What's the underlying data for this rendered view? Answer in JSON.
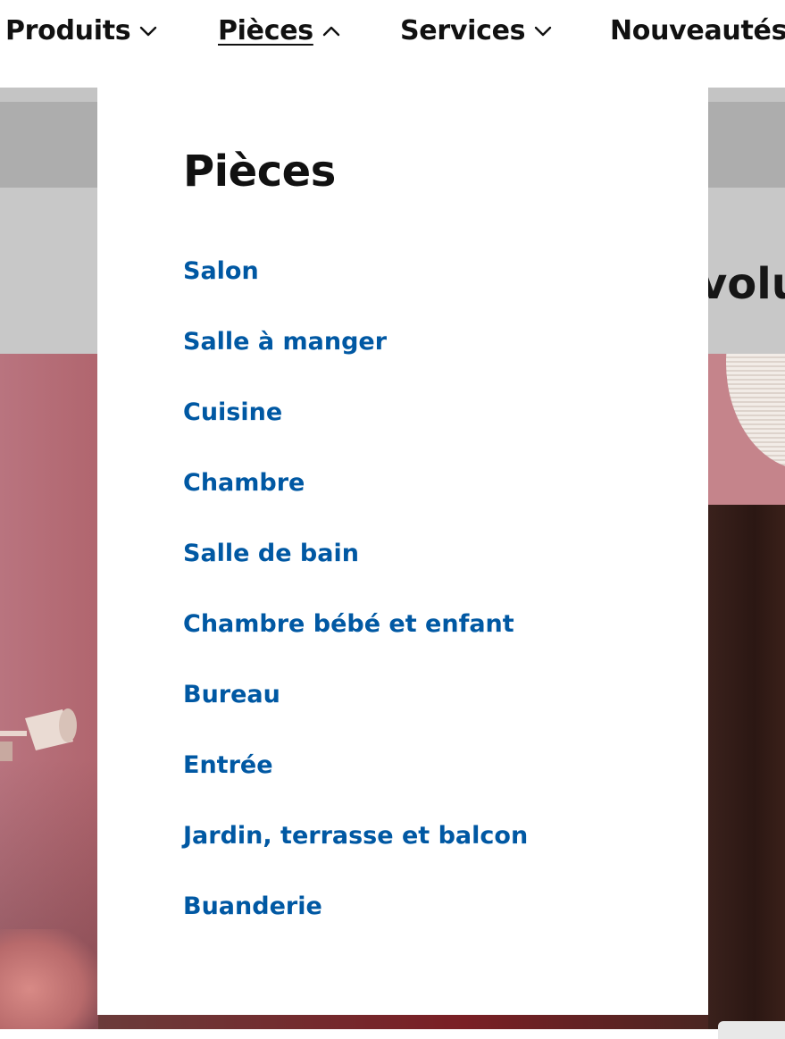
{
  "nav": {
    "items": [
      {
        "label": "Produits",
        "state": "collapsed"
      },
      {
        "label": "Pièces",
        "state": "expanded"
      },
      {
        "label": "Services",
        "state": "collapsed"
      },
      {
        "label": "Nouveautés",
        "state": "collapsed"
      }
    ]
  },
  "background": {
    "heading_fragment": "volu"
  },
  "dropdown": {
    "title": "Pièces",
    "links": [
      "Salon",
      "Salle à manger",
      "Cuisine",
      "Chambre",
      "Salle de bain",
      "Chambre bébé et enfant",
      "Bureau",
      "Entrée",
      "Jardin, terrasse et balcon",
      "Buanderie"
    ]
  },
  "colors": {
    "link": "#0058a3",
    "text": "#111111",
    "overlay_band": "#adadad"
  },
  "icons": {
    "collapsed": "chevron-down-icon",
    "expanded": "chevron-up-icon"
  }
}
